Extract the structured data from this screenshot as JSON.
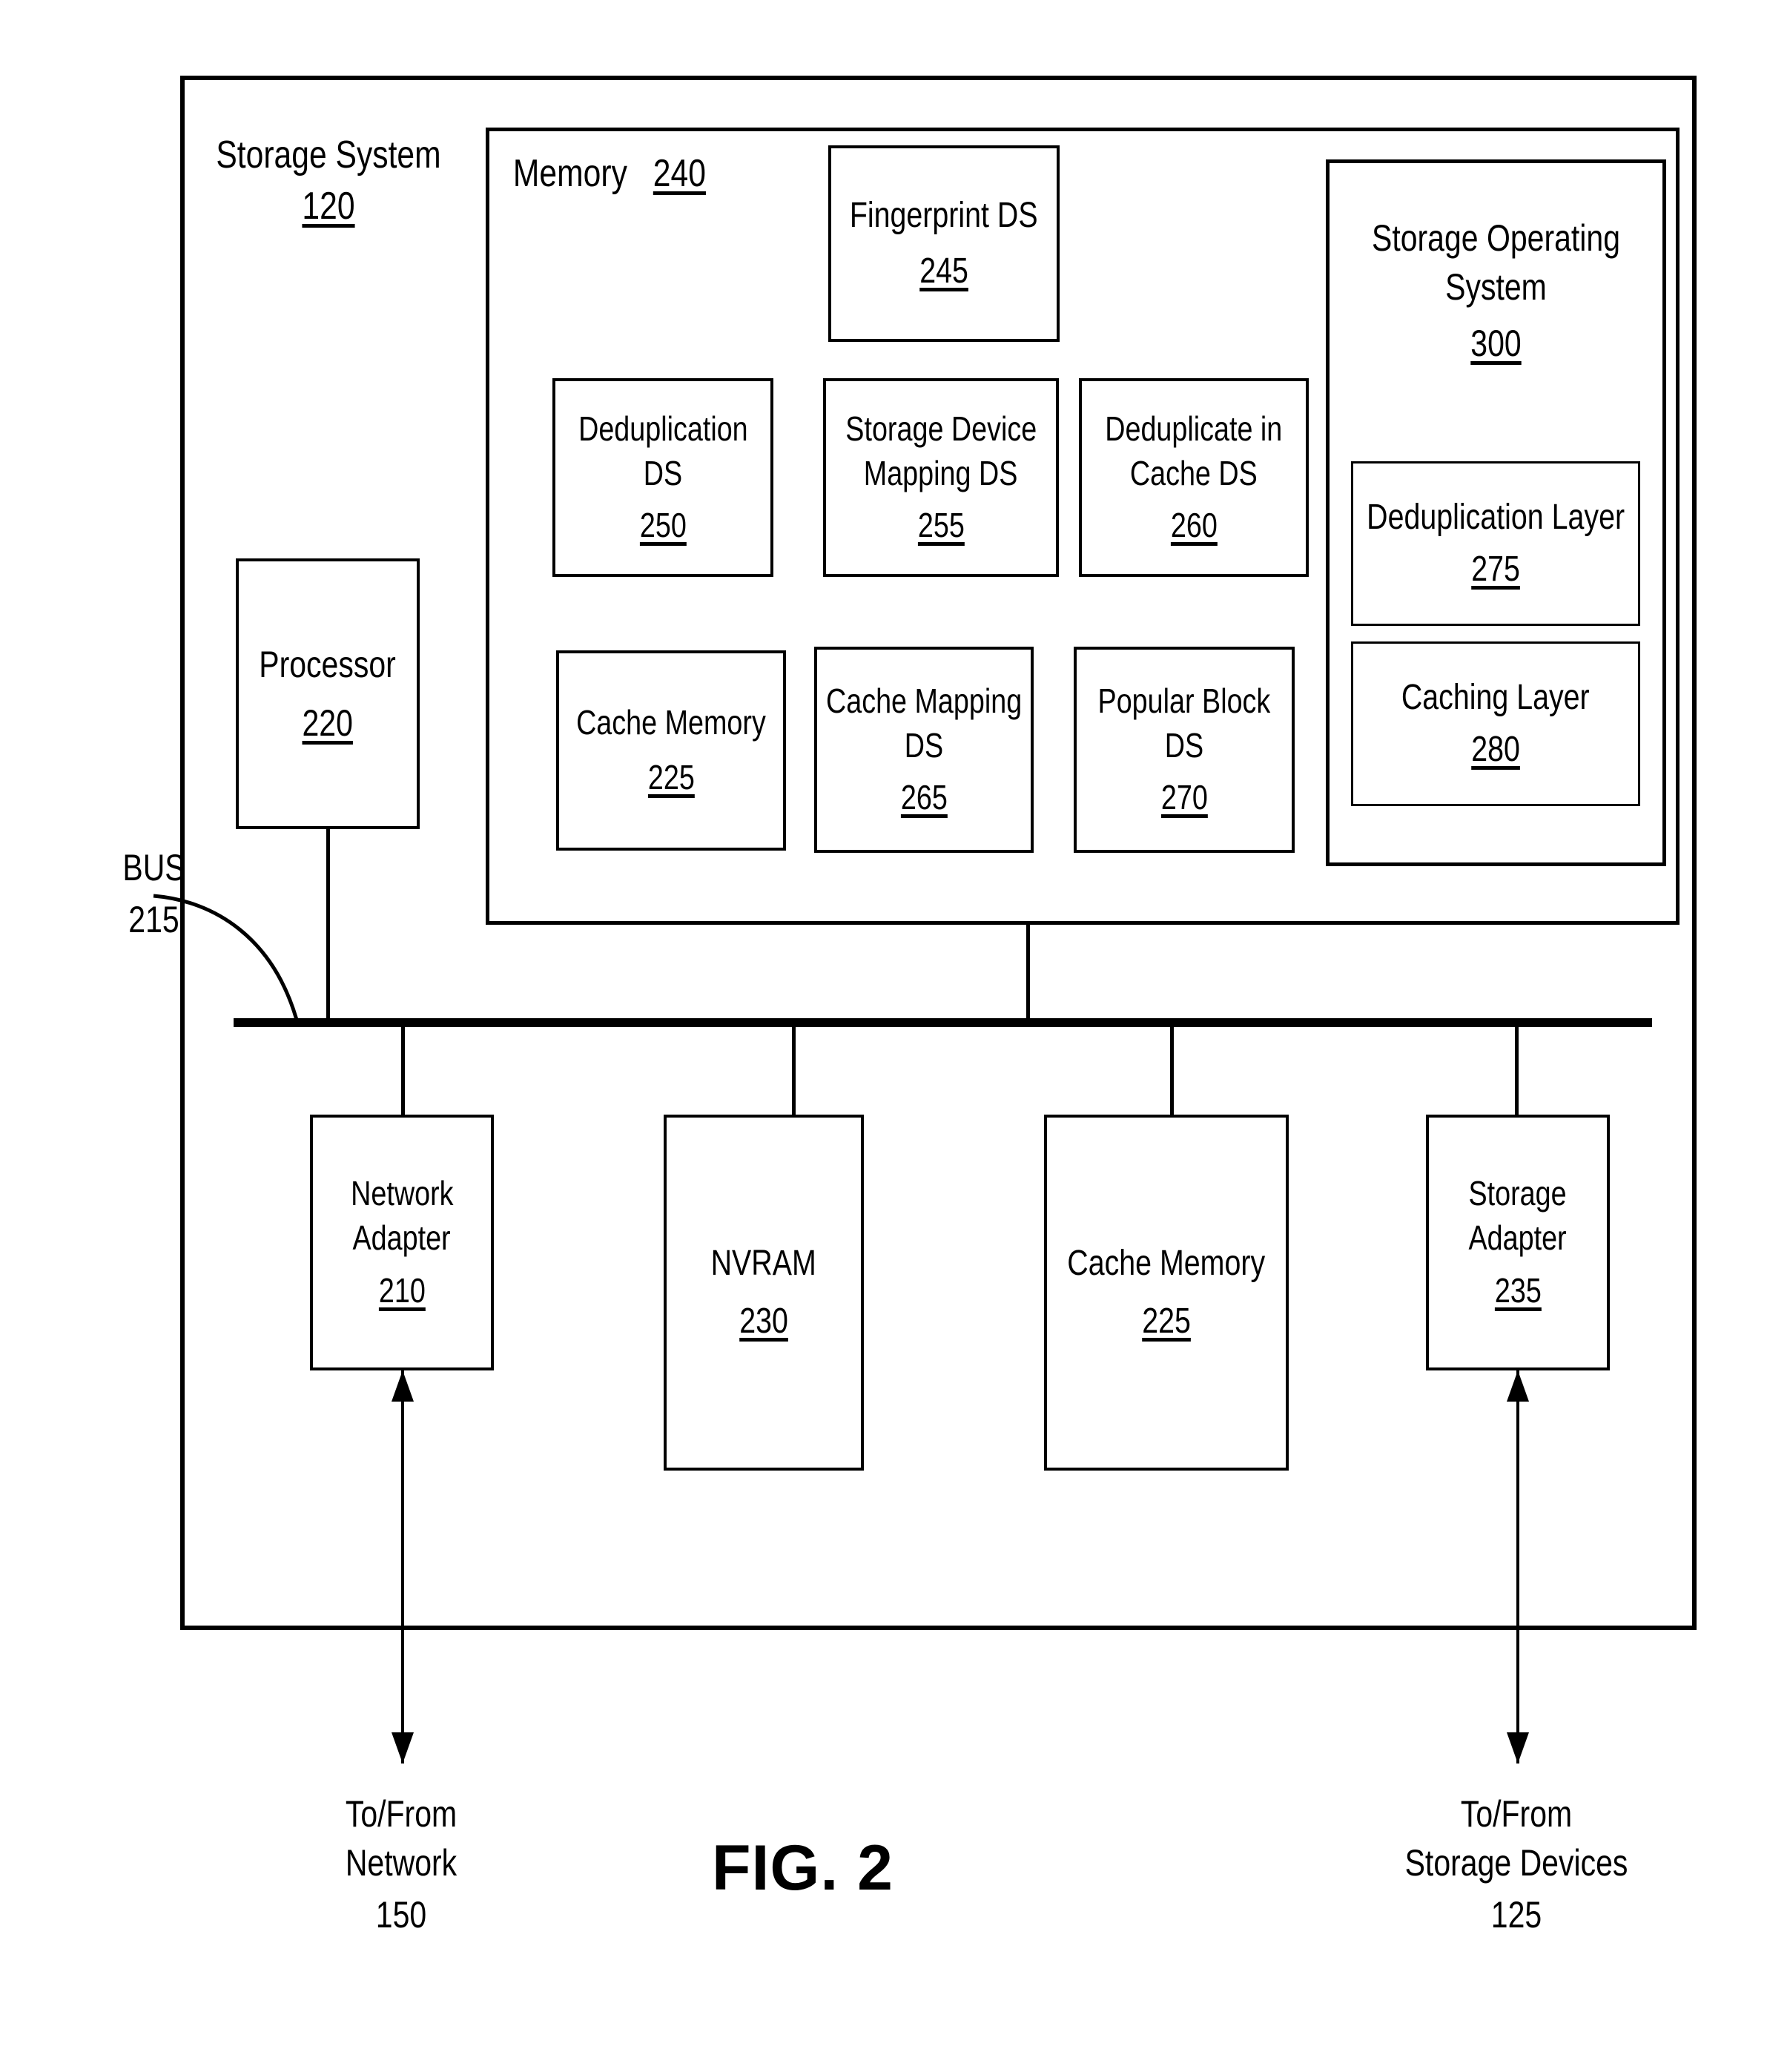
{
  "figure": {
    "caption": "FIG. 2",
    "outer_block": {
      "title": "Storage System",
      "ref": "120"
    }
  },
  "memory": {
    "title": "Memory",
    "ref": "240",
    "components": [
      {
        "name": "fingerprint-ds",
        "line1": "Fingerprint DS",
        "line2": "",
        "ref": "245"
      },
      {
        "name": "deduplication-ds",
        "line1": "Deduplication",
        "line2": "DS",
        "ref": "250"
      },
      {
        "name": "storage-device-mapping-ds",
        "line1": "Storage Device",
        "line2": "Mapping DS",
        "ref": "255"
      },
      {
        "name": "deduplicate-in-cache-ds",
        "line1": "Deduplicate in",
        "line2": "Cache DS",
        "ref": "260"
      },
      {
        "name": "cache-memory-ds",
        "line1": "Cache Memory",
        "line2": "",
        "ref": "225"
      },
      {
        "name": "cache-mapping-ds",
        "line1": "Cache Mapping",
        "line2": "DS",
        "ref": "265"
      },
      {
        "name": "popular-block-ds",
        "line1": "Popular Block",
        "line2": "DS",
        "ref": "270"
      }
    ]
  },
  "storage_operating_system": {
    "line1": "Storage Operating",
    "line2": "System",
    "ref": "300",
    "layers": [
      {
        "name": "deduplication-layer",
        "label": "Deduplication Layer",
        "ref": "275"
      },
      {
        "name": "caching-layer",
        "label": "Caching Layer",
        "ref": "280"
      }
    ]
  },
  "processor": {
    "label": "Processor",
    "ref": "220"
  },
  "bus": {
    "label": "BUS",
    "ref": "215"
  },
  "peripherals": [
    {
      "name": "network-adapter",
      "line1": "Network",
      "line2": "Adapter",
      "ref": "210"
    },
    {
      "name": "nvram",
      "line1": "NVRAM",
      "line2": "",
      "ref": "230"
    },
    {
      "name": "cache-memory",
      "line1": "Cache Memory",
      "line2": "",
      "ref": "225"
    },
    {
      "name": "storage-adapter",
      "line1": "Storage",
      "line2": "Adapter",
      "ref": "235"
    }
  ],
  "external": [
    {
      "name": "to-from-network",
      "line1": "To/From",
      "line2": "Network",
      "ref": "150"
    },
    {
      "name": "to-from-storage-devices",
      "line1": "To/From",
      "line2": "Storage Devices",
      "ref": "125"
    }
  ],
  "colors": {
    "ink": "#000000",
    "paper": "#ffffff"
  }
}
